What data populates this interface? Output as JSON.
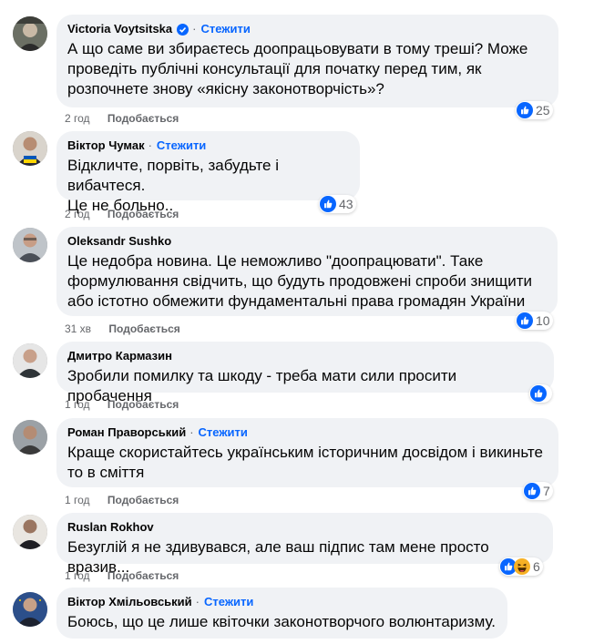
{
  "comments": [
    {
      "author": "Victoria Voytsitska",
      "verified": true,
      "follow": "Стежити",
      "lines": [
        "А що саме ви збираєтесь доопрацьовувати в тому треші? Може",
        "проведіть публічні консультації для початку перед тим, як",
        "розпочнете знову «якісну законотворчість»?"
      ],
      "time": "2 год",
      "like_label": "Подобається",
      "reactions": [
        "like-icon"
      ],
      "reaction_count": "25"
    },
    {
      "author": "Віктор Чумак",
      "verified": false,
      "follow": "Стежити",
      "lines": [
        "Відкличте, порвіть, забудьте і вибачтеся.",
        "Це не больно.."
      ],
      "time": "2 год",
      "like_label": "Подобається",
      "reactions": [
        "like-icon"
      ],
      "reaction_count": "43"
    },
    {
      "author": "Oleksandr Sushko",
      "verified": false,
      "follow": "",
      "lines": [
        "Це недобра новина. Це неможливо \"доопрацювати\". Таке",
        "формулювання свідчить, що будуть продовжені спроби знищити",
        "або істотно обмежити фундаментальні права громадян України"
      ],
      "time": "31 хв",
      "like_label": "Подобається",
      "reactions": [
        "like-icon"
      ],
      "reaction_count": "10"
    },
    {
      "author": "Дмитро Кармазин",
      "verified": false,
      "follow": "",
      "lines": [
        "Зробили помилку та шкоду - треба мати сили просити пробачення"
      ],
      "time": "1 год",
      "like_label": "Подобається",
      "reactions": [
        "like-icon"
      ],
      "reaction_count": ""
    },
    {
      "author": "Роман Праворський",
      "verified": false,
      "follow": "Стежити",
      "lines": [
        "Краще скористайтесь українським історичним досвідом і викиньте",
        "то в сміття"
      ],
      "time": "1 год",
      "like_label": "Подобається",
      "reactions": [
        "like-icon"
      ],
      "reaction_count": "7"
    },
    {
      "author": "Ruslan Rokhov",
      "verified": false,
      "follow": "",
      "lines": [
        "Безуглій я не здивувався, але ваш підпис там мене просто вразив..."
      ],
      "time": "1 год",
      "like_label": "Подобається",
      "reactions": [
        "like-icon",
        "haha-icon"
      ],
      "reaction_count": "6"
    },
    {
      "author": "Віктор Хмільовський",
      "verified": false,
      "follow": "Стежити",
      "lines": [
        "Боюсь, що це лише квіточки законотворчого волюнтаризму."
      ],
      "time": "",
      "like_label": "",
      "reactions": [],
      "reaction_count": ""
    }
  ],
  "colors": {
    "bubble": "#f0f2f5",
    "follow": "#0866ff",
    "meta": "#65676b",
    "like_reaction": "#0866ff",
    "haha_reaction": "#f7b125"
  }
}
